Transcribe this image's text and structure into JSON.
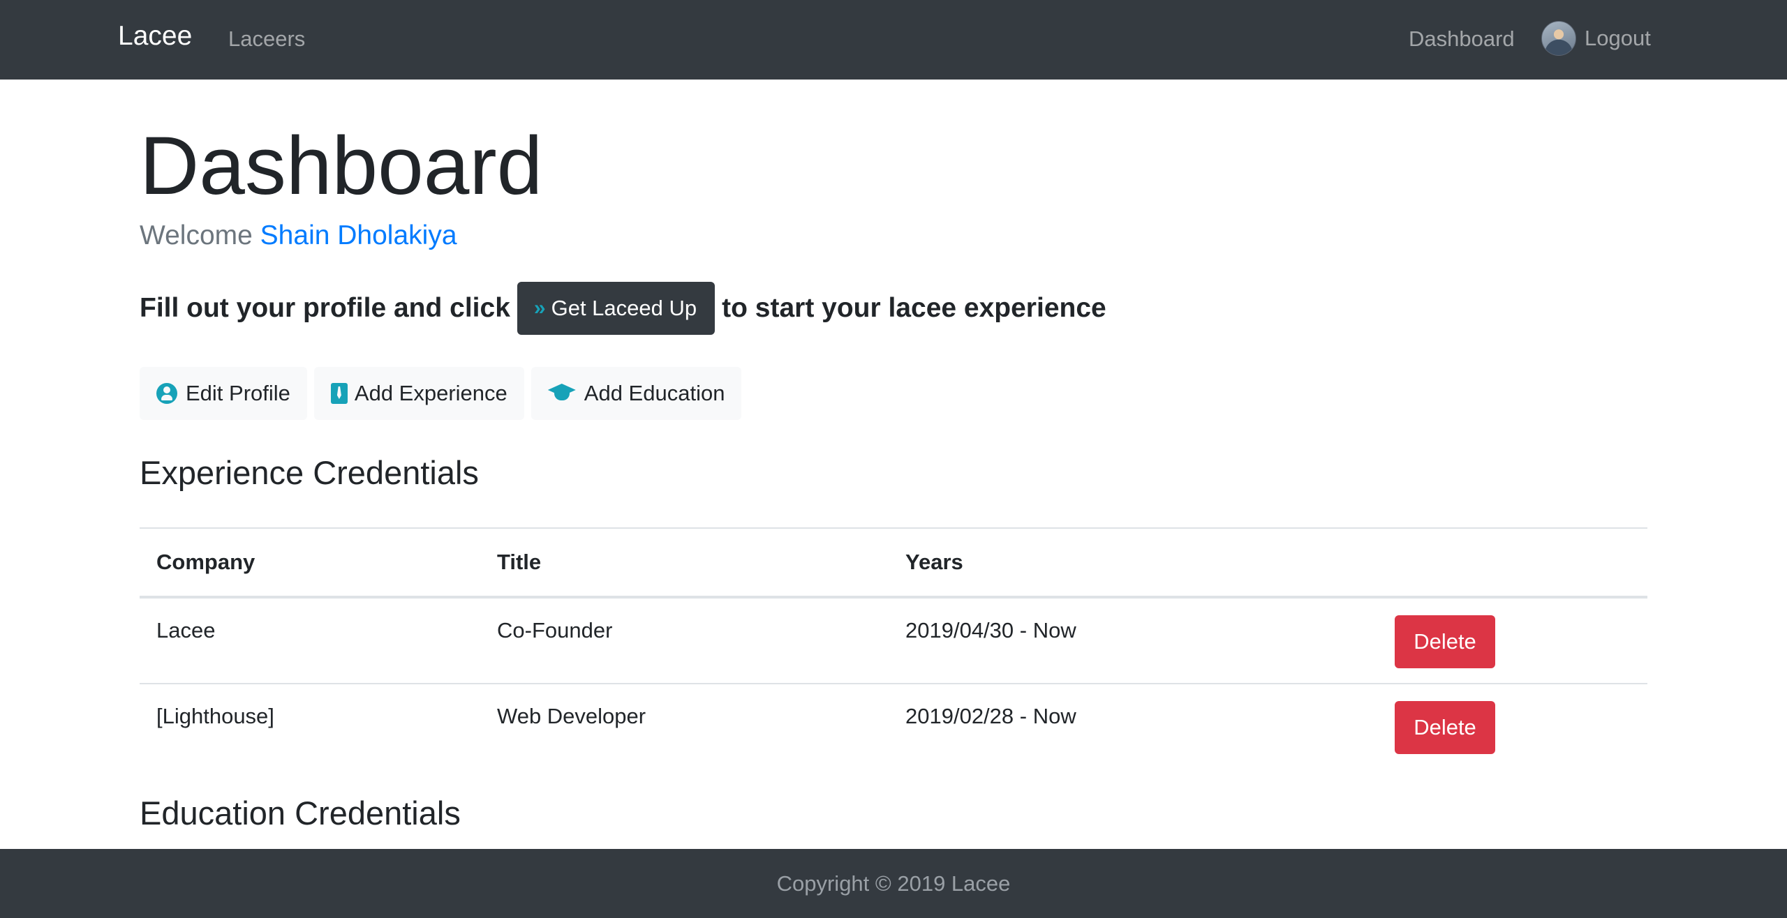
{
  "navbar": {
    "brand": "Lacee",
    "links": {
      "laceers": "Laceers",
      "dashboard": "Dashboard",
      "logout": "Logout"
    }
  },
  "page": {
    "title": "Dashboard",
    "welcome_prefix": "Welcome",
    "user_name": "Shain Dholakiya",
    "cta_before": "Fill out your profile and click",
    "cta_button": "Get Laceed Up",
    "cta_after": "to start your lacee experience"
  },
  "actions": [
    {
      "label": "Edit Profile",
      "icon": "user-circle-icon"
    },
    {
      "label": "Add Experience",
      "icon": "tie-icon"
    },
    {
      "label": "Add Education",
      "icon": "graduation-cap-icon"
    }
  ],
  "experience": {
    "heading": "Experience Credentials",
    "columns": [
      "Company",
      "Title",
      "Years"
    ],
    "rows": [
      {
        "company": "Lacee",
        "title": "Co-Founder",
        "years": "2019/04/30 - Now",
        "action": "Delete"
      },
      {
        "company": "[Lighthouse]",
        "title": "Web Developer",
        "years": "2019/02/28 - Now",
        "action": "Delete"
      }
    ]
  },
  "education": {
    "heading": "Education Credentials"
  },
  "footer": {
    "text": "Copyright © 2019 Lacee"
  },
  "colors": {
    "navbar": "#343a40",
    "link": "#007bff",
    "danger": "#dc3545",
    "icon_accent": "#17a2b8"
  }
}
